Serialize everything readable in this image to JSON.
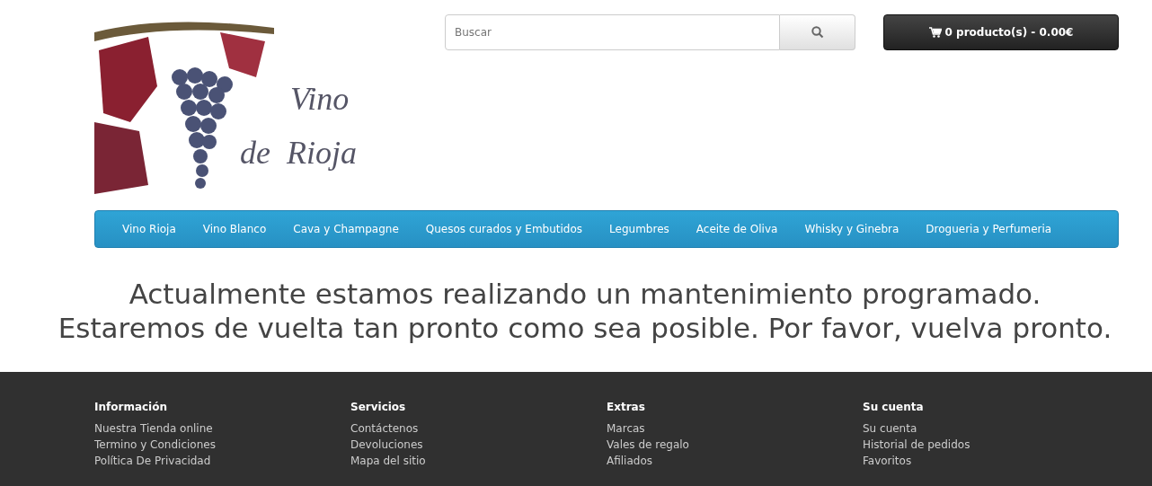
{
  "logo": {
    "line_1": "Vino",
    "line_2": "de  Rioja"
  },
  "search": {
    "placeholder": "Buscar"
  },
  "cart": {
    "label": "0 producto(s) - 0.00€"
  },
  "menu": [
    {
      "label": "Vino Rioja"
    },
    {
      "label": "Vino Blanco"
    },
    {
      "label": "Cava y Champagne"
    },
    {
      "label": "Quesos curados y Embutidos"
    },
    {
      "label": "Legumbres"
    },
    {
      "label": "Aceite de Oliva"
    },
    {
      "label": "Whisky y Ginebra"
    },
    {
      "label": "Drogueria y Perfumeria"
    }
  ],
  "message": [
    "Actualmente estamos realizando un mantenimiento programado.",
    "Estaremos de vuelta tan pronto como sea posible. Por favor, vuelva pronto."
  ],
  "footer": [
    {
      "heading": "Información",
      "links": [
        "Nuestra Tienda online",
        "Termino y Condiciones",
        "Política De Privacidad"
      ]
    },
    {
      "heading": "Servicios",
      "links": [
        "Contáctenos",
        "Devoluciones",
        "Mapa del sitio"
      ]
    },
    {
      "heading": "Extras",
      "links": [
        "Marcas",
        "Vales de regalo",
        "Afiliados"
      ]
    },
    {
      "heading": "Su cuenta",
      "links": [
        "Su cuenta",
        "Historial de pedidos",
        "Favoritos"
      ]
    }
  ]
}
